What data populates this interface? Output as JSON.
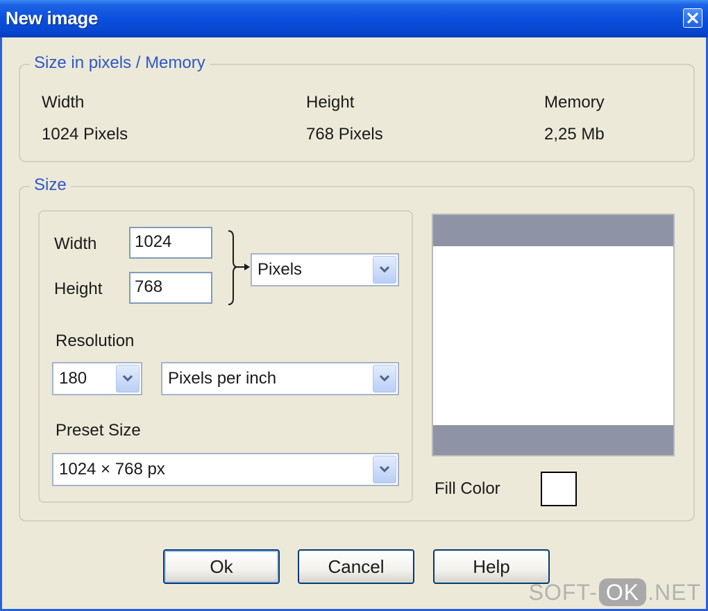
{
  "window": {
    "title": "New image"
  },
  "memory_group": {
    "legend": "Size in pixels / Memory",
    "width_label": "Width",
    "width_value": "1024 Pixels",
    "height_label": "Height",
    "height_value": "768 Pixels",
    "memory_label": "Memory",
    "memory_value": "2,25 Mb"
  },
  "size_group": {
    "legend": "Size",
    "width_label": "Width",
    "width_value": "1024",
    "height_label": "Height",
    "height_value": "768",
    "unit_value": "Pixels",
    "resolution_label": "Resolution",
    "resolution_value": "180",
    "resolution_unit": "Pixels per inch",
    "preset_label": "Preset Size",
    "preset_value": "1024 × 768 px",
    "fill_color_label": "Fill Color",
    "fill_color": "#ffffff"
  },
  "buttons": {
    "ok": "Ok",
    "cancel": "Cancel",
    "help": "Help"
  },
  "watermark": {
    "left": "SOFT-",
    "pill": "OK",
    "right": ".NET"
  },
  "colors": {
    "title_bar": "#0a4fdd",
    "legend_text": "#2f57c8",
    "preview_band": "#8e93a6"
  },
  "icons": {
    "close": "close-icon",
    "dropdown": "chevron-down-icon",
    "link": "bracket-arrow-icon"
  }
}
